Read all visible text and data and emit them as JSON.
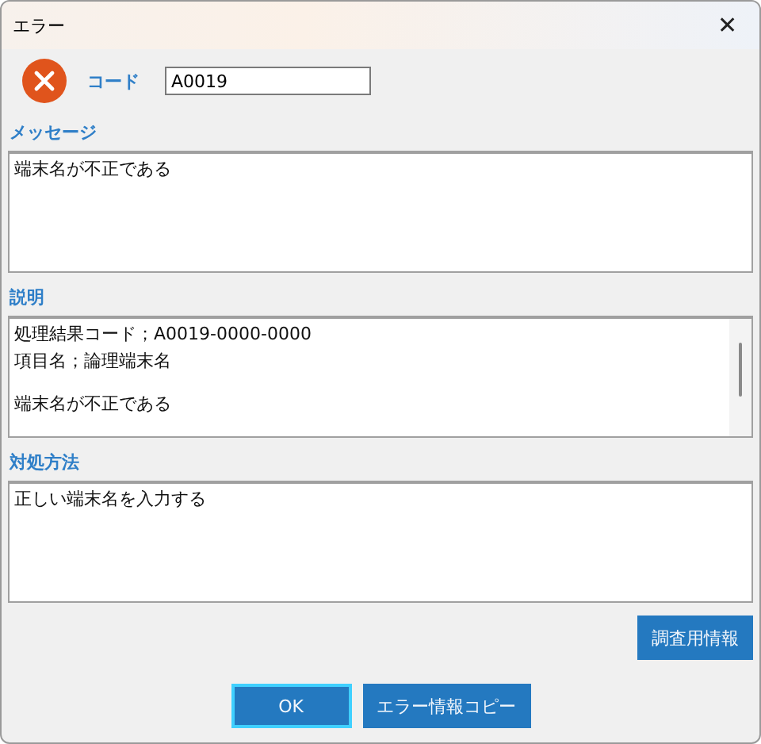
{
  "window": {
    "title": "エラー",
    "close": "✕"
  },
  "code": {
    "label": "コード",
    "value": "A0019"
  },
  "sections": [
    {
      "label": "メッセージ",
      "paragraphs": [
        [
          "端末名が不正である"
        ]
      ],
      "scrollbar": false
    },
    {
      "label": "説明",
      "paragraphs": [
        [
          "処理結果コード；A0019-0000-0000",
          "項目名；論理端末名"
        ],
        [
          "端末名が不正である"
        ]
      ],
      "scrollbar": true
    },
    {
      "label": "対処方法",
      "paragraphs": [
        [
          "正しい端末名を入力する"
        ]
      ],
      "scrollbar": false
    }
  ],
  "detail_button": "調査用情報",
  "buttons": [
    {
      "label": "OK",
      "focused": true
    },
    {
      "label": "エラー情報コピー",
      "focused": false
    }
  ]
}
